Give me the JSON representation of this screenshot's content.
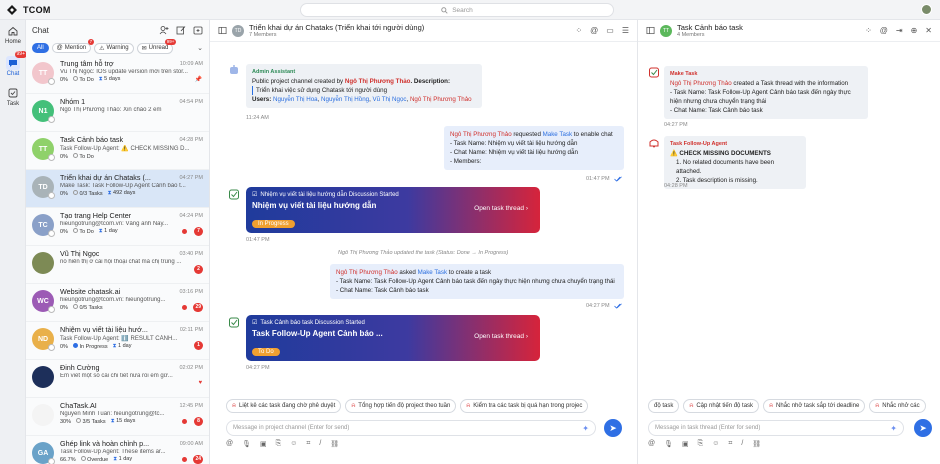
{
  "app": {
    "name": "TCOM",
    "search_placeholder": "Search"
  },
  "rail": [
    {
      "label": "Home",
      "icon": "home-icon",
      "badge": ""
    },
    {
      "label": "Chat",
      "icon": "chat-icon",
      "badge": "99+"
    },
    {
      "label": "Task",
      "icon": "task-icon",
      "badge": ""
    }
  ],
  "chatlist": {
    "title": "Chat",
    "filters": [
      {
        "label": "All",
        "count": ""
      },
      {
        "label": "Mention",
        "count": "7"
      },
      {
        "label": "Warning",
        "count": ""
      },
      {
        "label": "Unread",
        "count": "99+"
      }
    ],
    "conversations": [
      {
        "initials": "TT",
        "color": "#f2c6cc",
        "name": "Trung tâm hỗ trợ",
        "time": "10:09 AM",
        "preview": "Vũ Thị Ngọc: IOS update version mới trên stor...",
        "meta1": "0%",
        "meta2": "To Do",
        "meta3": "5 days",
        "badge": "",
        "pinned": true,
        "heart": false,
        "reddot": false
      },
      {
        "initials": "N1",
        "color": "#44c07a",
        "name": "Nhóm 1",
        "time": "04:54 PM",
        "preview": "Ngô Thị Phương Thảo: Xin chào 2 em",
        "meta1": "",
        "meta2": "",
        "meta3": "",
        "badge": "",
        "pinned": false,
        "heart": false,
        "reddot": false
      },
      {
        "initials": "TT",
        "color": "#8fd16a",
        "name": "Task Cảnh báo task",
        "time": "04:28 PM",
        "preview": "Task Follow-Up Agent: ⚠️ CHECK MISSING D...",
        "meta1": "0%",
        "meta2": "To Do",
        "meta3": "",
        "badge": "",
        "pinned": false,
        "heart": false,
        "reddot": false
      },
      {
        "initials": "TD",
        "color": "#a9b3b8",
        "name": "Triển khai dự án Chataks (...",
        "time": "04:27 PM",
        "preview": "Make Task: Task Follow-Up Agent Cảnh báo t...",
        "meta1": "0%",
        "meta2": "0/3 Tasks",
        "meta3": "492 days",
        "badge": "",
        "pinned": false,
        "heart": false,
        "reddot": false
      },
      {
        "initials": "TC",
        "color": "#8aa0c8",
        "name": "Tạo trang Help Center",
        "time": "04:24 PM",
        "preview": "hieungotrung@tcom.vn: Vâng anh Nay...",
        "meta1": "0%",
        "meta2": "To Do",
        "meta3": "1 day",
        "badge": "7",
        "pinned": false,
        "heart": false,
        "reddot": true
      },
      {
        "initials": "",
        "color": "#7d8a55",
        "name": "Vũ Thị Ngọc",
        "time": "03:40 PM",
        "preview": "nó hiển thị ở cái hội thoại chat mà chị trùng ...",
        "meta1": "",
        "meta2": "",
        "meta3": "",
        "badge": "2",
        "pinned": false,
        "heart": false,
        "reddot": false
      },
      {
        "initials": "WC",
        "color": "#9c5bb5",
        "name": "Website chatask.ai",
        "time": "03:16 PM",
        "preview": "hieungotrung@tcom.vn: hieungotrung...",
        "meta1": "0%",
        "meta2": "0/5 Tasks",
        "meta3": "",
        "badge": "29",
        "pinned": false,
        "heart": false,
        "reddot": true
      },
      {
        "initials": "ND",
        "color": "#e9b04a",
        "name": "Nhiệm vụ viết tài liệu hướ...",
        "time": "02:11 PM",
        "preview": "Task Follow-Up Agent: ℹ️ RESULT CẢNH...",
        "meta1": "0%",
        "meta2": "In Progress",
        "meta3": "1 day",
        "badge": "1",
        "pinned": false,
        "heart": false,
        "reddot": false
      },
      {
        "initials": "",
        "color": "#1d2f5a",
        "name": "Đinh Cường",
        "time": "02:02 PM",
        "preview": "Em viết một số cái chi tiết nữa rồi em gử...",
        "meta1": "",
        "meta2": "",
        "meta3": "",
        "badge": "",
        "pinned": false,
        "heart": true,
        "reddot": false
      },
      {
        "initials": "",
        "color": "#f4f4f4",
        "name": "ChaTask.AI",
        "time": "12:45 PM",
        "preview": "Nguyễn Minh Tuấn: hieungotrung@tc...",
        "meta1": "30%",
        "meta2": "3/5 Tasks",
        "meta3": "15 days",
        "badge": "8",
        "pinned": false,
        "heart": false,
        "reddot": true
      },
      {
        "initials": "GA",
        "color": "#6aa2c8",
        "name": "Ghép link và hoàn chỉnh p...",
        "time": "09:00 AM",
        "preview": "Task Follow-Up Agent: These items ar...",
        "meta1": "66.7%",
        "meta2": "Overdue",
        "meta3": "1 day",
        "badge": "24",
        "pinned": false,
        "heart": false,
        "reddot": true
      }
    ]
  },
  "main": {
    "title": "Triển khai dự án Chataks (Triển khai tới người dùng)",
    "members": "7 Members",
    "admin_msg": {
      "sender": "Admin Assistant",
      "line1a": "Public project channel created by ",
      "line1b": "Ngô Thị Phương Thảo",
      "line1c": ". Description:",
      "quote": "Triển khai việc sử dụng Chatask tới người dùng",
      "users_label": "Users: ",
      "users": [
        "Nguyễn Thị Hoa",
        "Nguyễn Thị Hồng",
        "Vũ Thị Ngọc",
        "Ngô Thị Phương Thảo"
      ],
      "time": "11:24 AM"
    },
    "req_msg": {
      "a": "Ngô Thị Phương Thảo",
      "b": " requested ",
      "c": "Make Task",
      "d": " to enable chat",
      "l1": "- Task Name: Nhiệm vụ viết tài liệu hướng dẫn",
      "l2": "- Chat Name: Nhiệm vụ viết tài liệu hướng dẫn",
      "l3": "- Members:",
      "time": "01:47 PM"
    },
    "card1": {
      "header": "Nhiệm vụ viết tài liệu hướng dẫn Discussion Started",
      "title": "Nhiệm vụ viết tài liệu hướng dẫn",
      "open": "Open task thread",
      "status": "In Progress",
      "time": "01:47 PM"
    },
    "system_line": "Ngô Thị Phương Thảo updated the task (Status: Done → In Progress)",
    "ask_msg": {
      "a": "Ngô Thị Phương Thảo",
      "b": " asked ",
      "c": "Make Task",
      "d": " to create a task",
      "l1": "- Task Name: Task Follow-Up Agent Cảnh báo task đến ngày thực hiện nhưng chưa chuyển trạng thái",
      "l2": "- Chat Name: Task Cảnh báo task",
      "time": "04:27 PM"
    },
    "card2": {
      "header": "Task Cảnh báo task Discussion Started",
      "title": "Task Follow-Up Agent Cảnh báo ...",
      "open": "Open task thread",
      "status": "To Do",
      "time": "04:27 PM"
    },
    "suggestions": [
      "Liệt kê các task đang chờ phê duyệt",
      "Tổng hợp tiến độ project theo tuần",
      "Kiểm tra các task bị quá hạn trong projec"
    ],
    "compose_placeholder": "Message in project channel (Enter for send)"
  },
  "side": {
    "title": "Task Cảnh báo task",
    "members": "4 Members",
    "mk_msg": {
      "sender": "Make Task",
      "l0a": "Ngô Thị Phương Thảo",
      "l0b": " created a Task thread with the information",
      "l1": "- Task Name: Task Follow-Up Agent Cảnh báo task đến ngày thực hiện nhưng chưa chuyển trạng thái",
      "l2": "- Chat Name: Task Cảnh báo task",
      "time": "04:27 PM"
    },
    "fu_msg": {
      "sender": "Task Follow-Up Agent",
      "head": "⚠️ CHECK MISSING DOCUMENTS",
      "l1": "1. No related documents have been attached.",
      "l2": "2. Task description is missing.",
      "time": "04:28 PM"
    },
    "suggestions": [
      "độ task",
      "Cập nhật tiến độ task",
      "Nhắc nhở task sắp tới deadline",
      "Nhắc nhở các"
    ],
    "compose_placeholder": "Message in task thread (Enter for send)"
  }
}
